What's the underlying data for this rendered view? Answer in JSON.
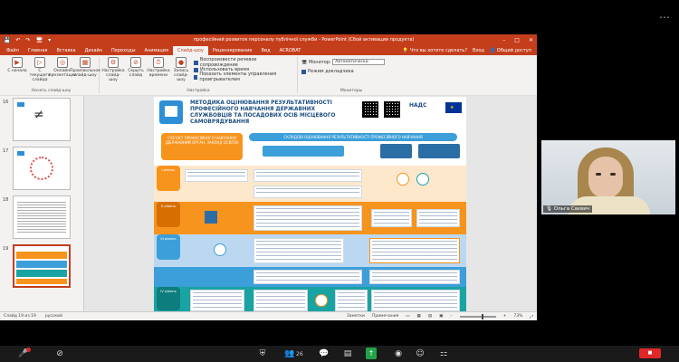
{
  "app": {
    "window_title": "професійний розвиток персоналу публічної служби - PowerPoint (Сбой активации продукта)"
  },
  "quick_access": [
    "💾",
    "↶",
    "↷",
    "🖥",
    "▾"
  ],
  "tabs": [
    "Файл",
    "Главная",
    "Вставка",
    "Дизайн",
    "Переходы",
    "Анимация",
    "Слайд-шоу",
    "Рецензирование",
    "Вид",
    "ACROBAT"
  ],
  "active_tab_index": 6,
  "tell_me": "Что вы хотите сделать?",
  "sign_in": "Вход",
  "share": "Общий доступ",
  "ribbon": {
    "start_group": {
      "label": "Начать слайд-шоу",
      "buttons": [
        "С начала",
        "С текущего слайда",
        "Онлайн-презентация",
        "Произвольное слайд-шоу"
      ]
    },
    "setup_group": {
      "label": "Настройка",
      "buttons": [
        "Настройка слайд-шоу",
        "Скрыть слайд",
        "Настройка времени",
        "Запись слайд-шоу"
      ]
    },
    "checkboxes": [
      "Воспроизвести речевое сопровождение",
      "Использовать время",
      "Показать элементы управления проигрывателем"
    ],
    "monitors": {
      "label": "Мониторы",
      "monitor_label": "Монитор:",
      "monitor_value": "Автоматически",
      "presenter_view": "Режим докладчика"
    }
  },
  "thumbnails": [
    {
      "num": "16"
    },
    {
      "num": "17"
    },
    {
      "num": "18"
    },
    {
      "num": "19"
    }
  ],
  "slide": {
    "title": "МЕТОДИКА ОЦІНЮВАННЯ РЕЗУЛЬТАТИВНОСТІ ПРОФЕСІЙНОГО НАВЧАННЯ ДЕРЖАВНИХ СЛУЖБОВЦІВ ТА ПОСАДОВИХ ОСІБ МІСЦЕВОГО САМОВРЯДУВАННЯ",
    "org": "НАДС",
    "left_pill": "СУБ'ЄКТ ПРОФЕСІЙНОГО НАВЧАННЯ (ДЕРЖАВНИЙ ОРГАН, ЗАКЛАД ОСВІТИ)",
    "right_pill": "СКЛАДОВІ ОЦІНЮВАННЯ РЕЗУЛЬТАТИВНОСТІ ПРОФЕСІЙНОГО НАВЧАННЯ",
    "rows": [
      "I рівень",
      "II рівень",
      "III рівень",
      "IV рівень"
    ]
  },
  "status": {
    "slide_counter": "Слайд 19 из 19",
    "language": "русский",
    "notes": "Заметки",
    "comments": "Примечания",
    "zoom": "73%"
  },
  "webcam": {
    "name": "Ольга Саєвич"
  },
  "zoom_toolbar": {
    "participants": "26"
  },
  "colors": {
    "ppt_red": "#c43e1c",
    "slide_orange": "#f7941d",
    "slide_blue": "#3c9fd9",
    "slide_teal": "#1aa3a3"
  }
}
